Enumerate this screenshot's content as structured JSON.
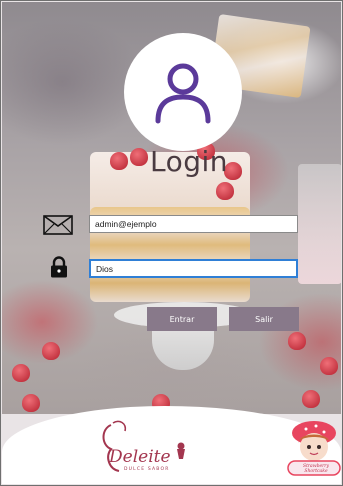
{
  "login": {
    "title": "Login",
    "email_value": "admin@ejemplo",
    "password_value": "Dios",
    "enter_label": "Entrar",
    "exit_label": "Salir"
  },
  "branding": {
    "primary_logo_text": "Deleite",
    "primary_logo_tagline": "DULCE SABOR",
    "partner_logo_text": "Strawberry Shortcake"
  },
  "colors": {
    "avatar_icon": "#5b3a9a",
    "button_bg": "#88798a",
    "focus_border": "#2f7fd6",
    "brand": "#a3364f"
  },
  "icons": {
    "avatar": "user-icon",
    "email": "envelope-icon",
    "password": "lock-icon"
  }
}
